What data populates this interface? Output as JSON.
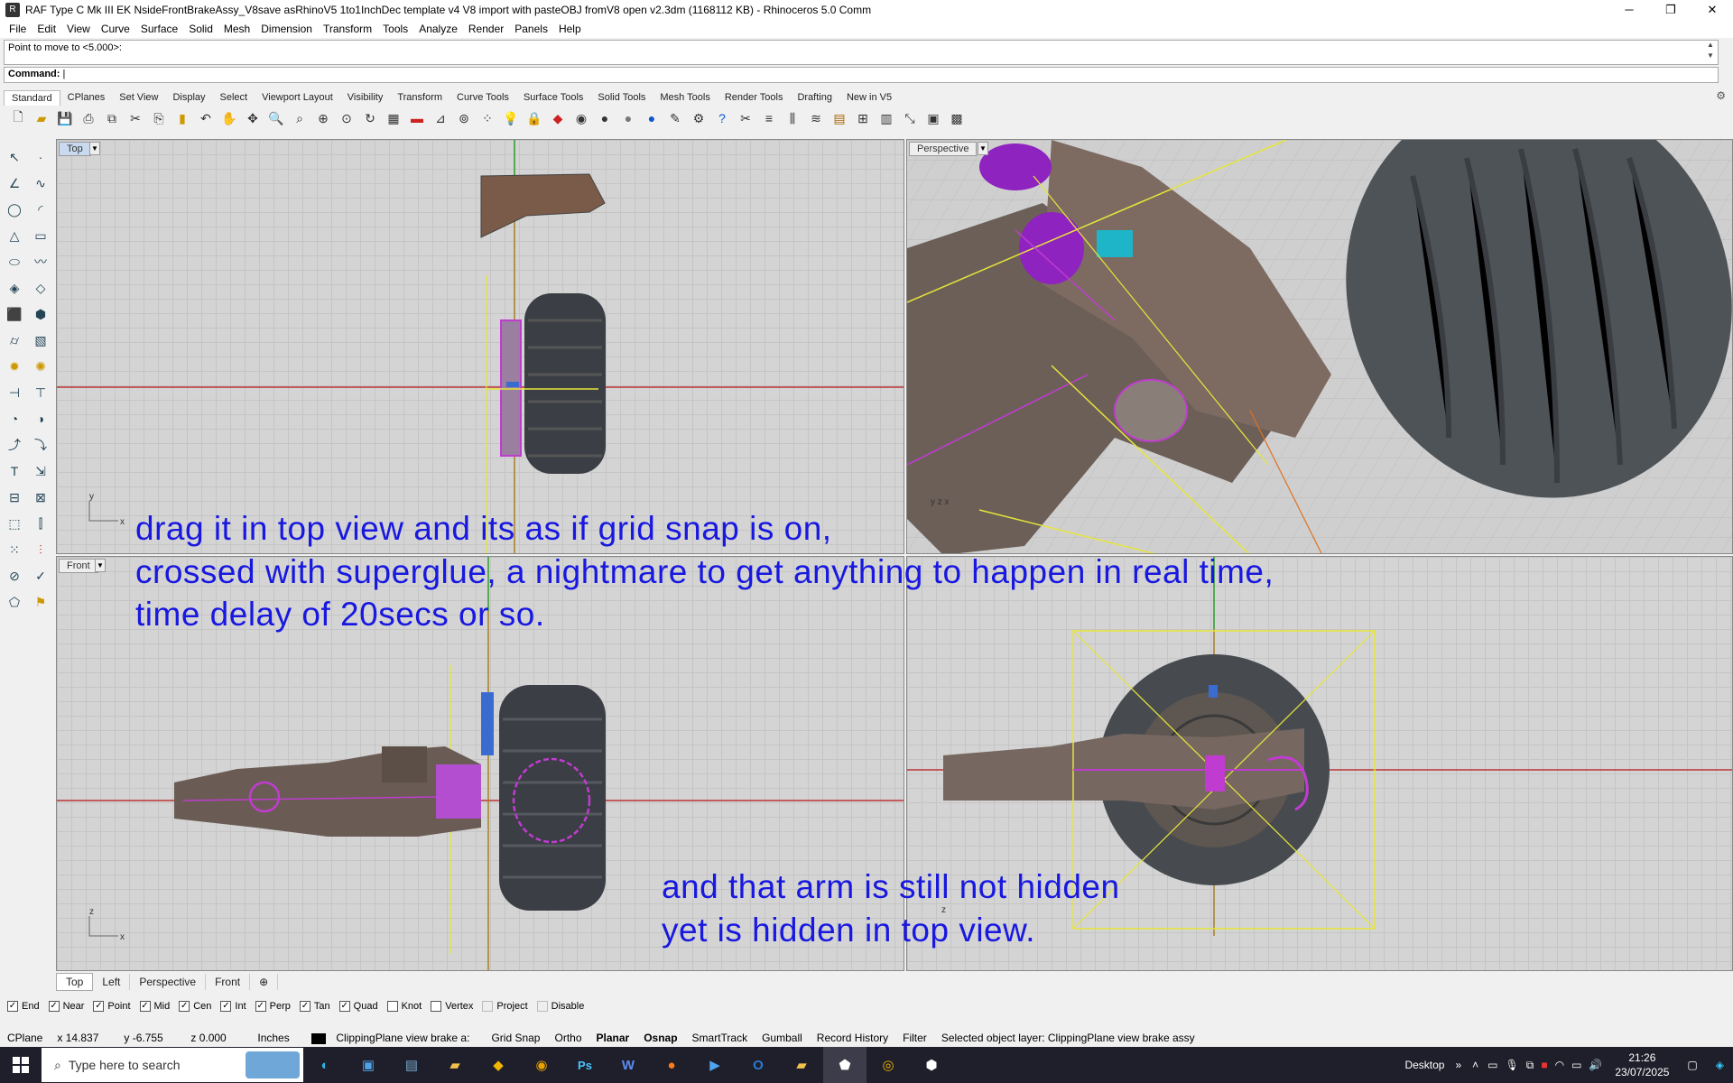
{
  "window": {
    "title": "RAF Type C Mk III EK NsideFrontBrakeAssy_V8save asRhinoV5 1to1InchDec template v4 V8 import with pasteOBJ fromV8 open v2.3dm (1168112 KB) - Rhinoceros 5.0 Comm",
    "minimize": "─",
    "restore": "❐",
    "close": "✕"
  },
  "menu": [
    "File",
    "Edit",
    "View",
    "Curve",
    "Surface",
    "Solid",
    "Mesh",
    "Dimension",
    "Transform",
    "Tools",
    "Analyze",
    "Render",
    "Panels",
    "Help"
  ],
  "command": {
    "history": "Point to move to <5.000>:",
    "label": "Command:"
  },
  "toolbar_tabs": [
    "Standard",
    "CPlanes",
    "Set View",
    "Display",
    "Select",
    "Viewport Layout",
    "Visibility",
    "Transform",
    "Curve Tools",
    "Surface Tools",
    "Solid Tools",
    "Mesh Tools",
    "Render Tools",
    "Drafting",
    "New in V5"
  ],
  "viewports": {
    "top": "Top",
    "perspective": "Perspective",
    "front": "Front"
  },
  "viewport_tabs": [
    "Top",
    "Left",
    "Perspective",
    "Front"
  ],
  "osnaps": [
    {
      "label": "End",
      "checked": true
    },
    {
      "label": "Near",
      "checked": true
    },
    {
      "label": "Point",
      "checked": true
    },
    {
      "label": "Mid",
      "checked": true
    },
    {
      "label": "Cen",
      "checked": true
    },
    {
      "label": "Int",
      "checked": true
    },
    {
      "label": "Perp",
      "checked": true
    },
    {
      "label": "Tan",
      "checked": true
    },
    {
      "label": "Quad",
      "checked": true
    },
    {
      "label": "Knot",
      "checked": false
    },
    {
      "label": "Vertex",
      "checked": false
    },
    {
      "label": "Project",
      "checked": false,
      "disabled": true
    },
    {
      "label": "Disable",
      "checked": false,
      "disabled": true
    }
  ],
  "status": {
    "cplane": "CPlane",
    "x": "x 14.837",
    "y": "y -6.755",
    "z": "z 0.000",
    "units": "Inches",
    "layer": "ClippingPlane view brake a:",
    "grid_snap": "Grid Snap",
    "ortho": "Ortho",
    "planar": "Planar",
    "osnap": "Osnap",
    "smarttrack": "SmartTrack",
    "gumball": "Gumball",
    "record_history": "Record History",
    "filter": "Filter",
    "message": "Selected object layer: ClippingPlane view brake assy"
  },
  "annotations": {
    "line1": "drag it in top view and its as if grid snap is on,",
    "line2": "crossed with superglue, a nightmare to get anything to happen in real time,",
    "line3": "time delay of 20secs or so.",
    "line4": "and that arm is still not hidden",
    "line5": "yet is hidden in top view."
  },
  "taskbar": {
    "search_placeholder": "Type here to search",
    "desktop": "Desktop",
    "time": "21:26",
    "date": "23/07/2025"
  }
}
